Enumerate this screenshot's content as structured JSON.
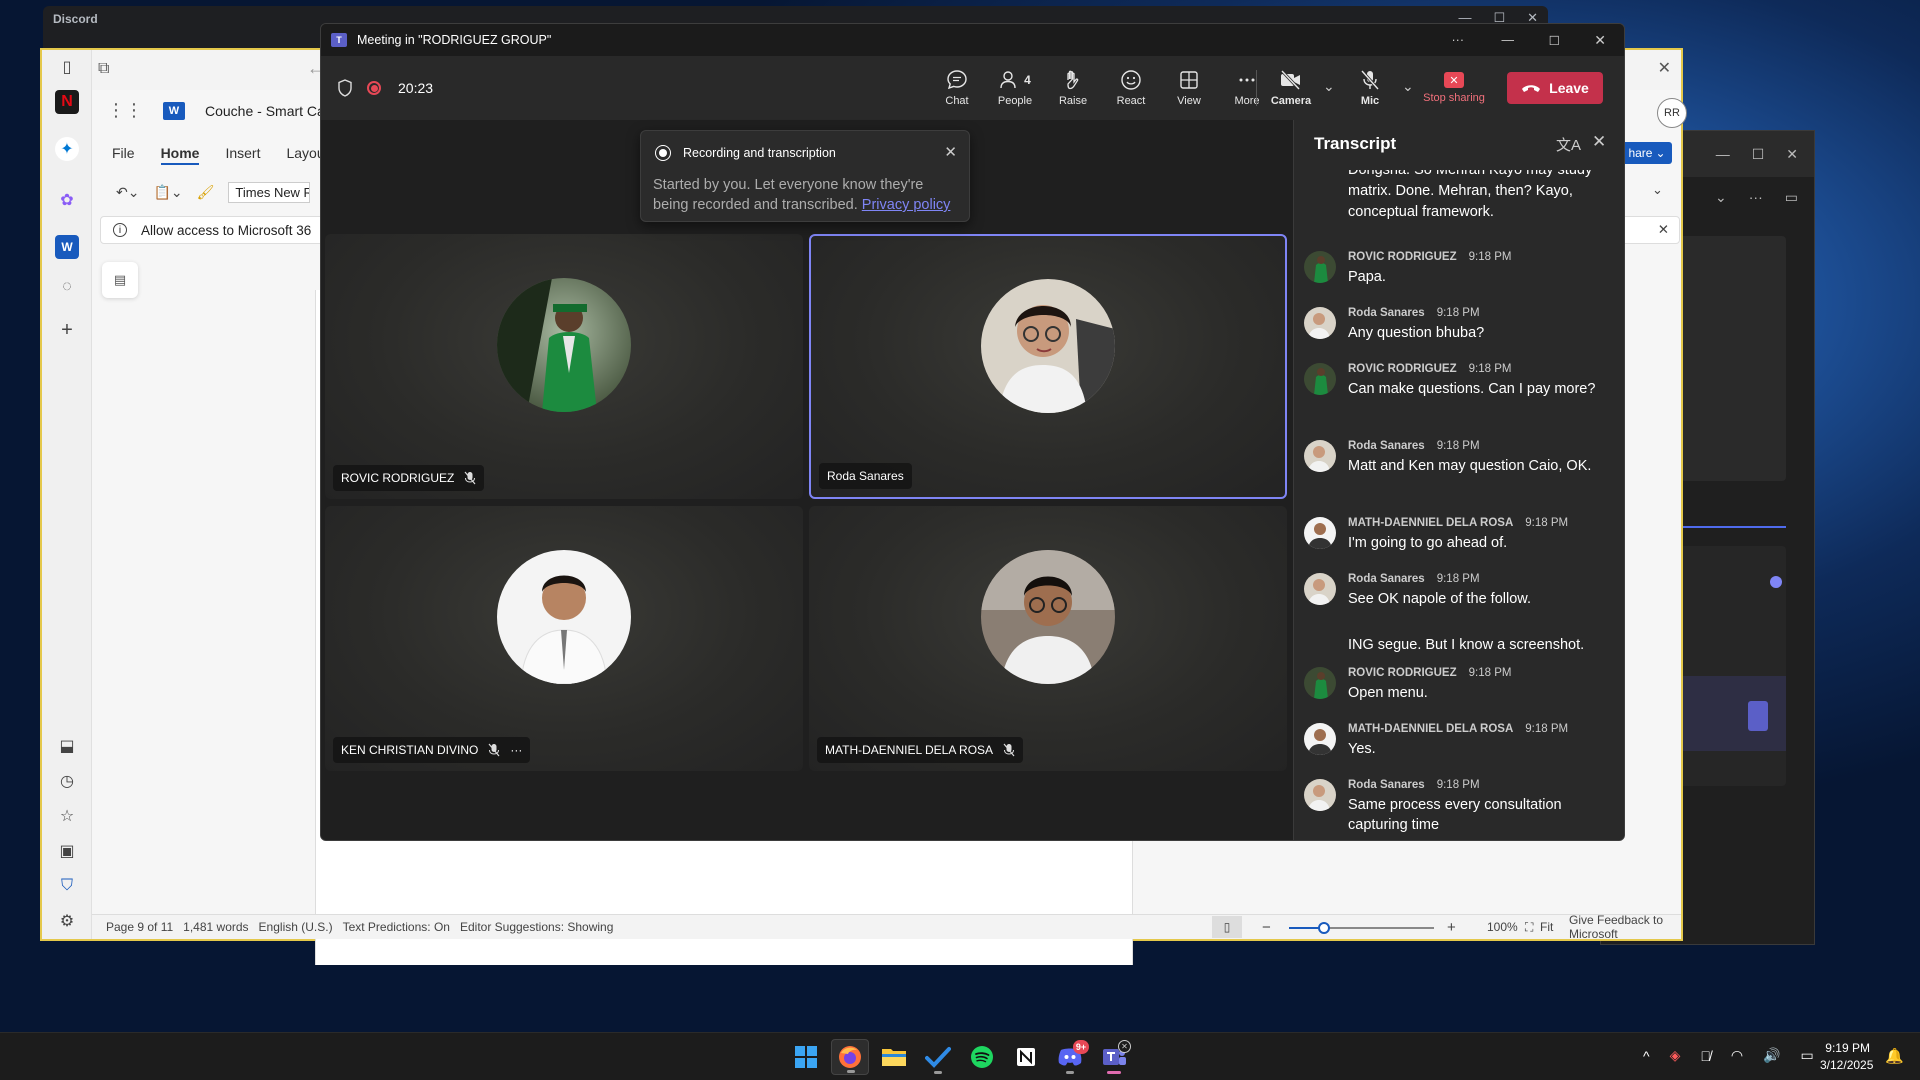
{
  "discord": {
    "title": "Discord"
  },
  "word": {
    "doc_title": "Couche - Smart Caf",
    "ribbon_tabs": [
      "File",
      "Home",
      "Insert",
      "Layout"
    ],
    "font_name": "Times New R",
    "info_bar": "Allow access to Microsoft 36",
    "status": {
      "page": "Page 9 of 11",
      "words": "1,481 words",
      "language": "English (U.S.)",
      "predictions": "Text Predictions: On",
      "editor": "Editor Suggestions: Showing",
      "zoom": "100%",
      "fit": "Fit",
      "feedback": "Give Feedback to Microsoft"
    },
    "zoom_slider_fraction": 0.24,
    "share_label": "hare",
    "profile_initials": "RR"
  },
  "teams": {
    "title": "Meeting in \"RODRIGUEZ GROUP\"",
    "timer": "20:23",
    "toolbar": {
      "chat": "Chat",
      "people": "People",
      "people_count": "4",
      "raise": "Raise",
      "react": "React",
      "view": "View",
      "more": "More",
      "camera": "Camera",
      "mic": "Mic",
      "stop_sharing": "Stop sharing",
      "leave": "Leave"
    },
    "notice": {
      "title": "Recording and transcription",
      "body": "Started by you. Let everyone know they're being recorded and transcribed.",
      "link": "Privacy policy"
    },
    "participants": [
      {
        "name": "ROVIC RODRIGUEZ",
        "muted": true
      },
      {
        "name": "Roda Sanares",
        "muted": false
      },
      {
        "name": "KEN CHRISTIAN DIVINO",
        "muted": true
      },
      {
        "name": "MATH-DAENNIEL DELA ROSA",
        "muted": true
      }
    ],
    "transcript": {
      "title": "Transcript",
      "top_fragment": "Dongsha. So Mehran Kayo may study matrix. Done. Mehran, then? Kayo, conceptual framework.",
      "entries": [
        {
          "speaker": "ROVIC RODRIGUEZ",
          "time": "9:18 PM",
          "text": "Papa."
        },
        {
          "speaker": "Roda Sanares",
          "time": "9:18 PM",
          "text": "Any question bhuba?"
        },
        {
          "speaker": "ROVIC RODRIGUEZ",
          "time": "9:18 PM",
          "text": "Can make questions. Can I pay more?"
        },
        {
          "speaker": "Roda Sanares",
          "time": "9:18 PM",
          "text": "Matt and Ken may question Caio, OK."
        },
        {
          "speaker": "MATH-DAENNIEL DELA ROSA",
          "time": "9:18 PM",
          "text": "I'm going to go ahead of."
        },
        {
          "speaker": "Roda Sanares",
          "time": "9:18 PM",
          "text": "See OK napole of the follow."
        },
        {
          "speaker": "",
          "time": "",
          "text": "ING segue. But I know a screenshot."
        },
        {
          "speaker": "ROVIC RODRIGUEZ",
          "time": "9:18 PM",
          "text": "Open menu."
        },
        {
          "speaker": "MATH-DAENNIEL DELA ROSA",
          "time": "9:18 PM",
          "text": "Yes."
        },
        {
          "speaker": "Roda Sanares",
          "time": "9:18 PM",
          "text": "Same process every consultation capturing time"
        }
      ]
    }
  },
  "taskbar": {
    "time": "9:19 PM",
    "date": "3/12/2025",
    "discord_badge": "9+"
  }
}
